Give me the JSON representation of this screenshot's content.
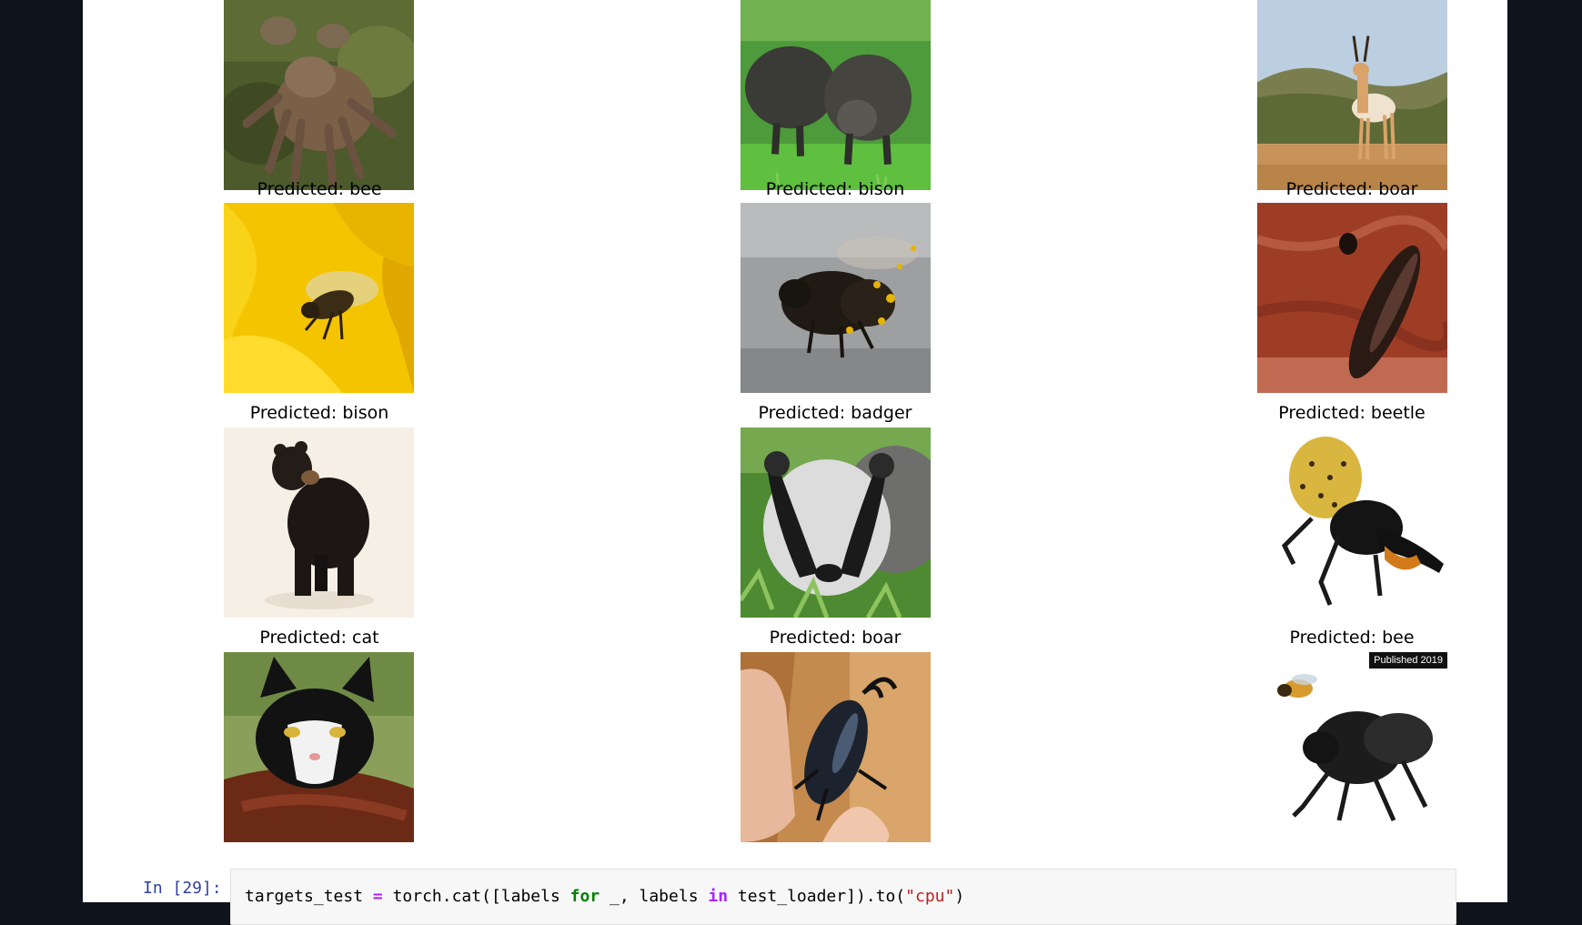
{
  "notebook": {
    "output": {
      "rows": [
        {
          "cells": [
            {
              "caption": "",
              "image": "tarantula-photo"
            },
            {
              "caption": "",
              "image": "boar-photo"
            },
            {
              "caption": "",
              "image": "antelope-photo"
            }
          ]
        },
        {
          "cells": [
            {
              "caption": "Predicted: bee",
              "image": "bee-on-yellow-flower-photo"
            },
            {
              "caption": "Predicted: bison",
              "image": "bee-with-pollen-photo"
            },
            {
              "caption": "Predicted: boar",
              "image": "beetle-on-rust-photo"
            }
          ]
        },
        {
          "cells": [
            {
              "caption": "Predicted: bison",
              "image": "black-bear-photo"
            },
            {
              "caption": "Predicted: badger",
              "image": "badger-photo"
            },
            {
              "caption": "Predicted: beetle",
              "image": "hercules-beetle-photo"
            }
          ]
        },
        {
          "cells": [
            {
              "caption": "Predicted: cat",
              "image": "cat-photo"
            },
            {
              "caption": "Predicted: boar",
              "image": "stag-beetle-in-hand-photo"
            },
            {
              "caption": "Predicted: bee",
              "image": "giant-bee-comparison-photo"
            }
          ]
        }
      ],
      "watermark_text": "Published 2019"
    },
    "next_cell": {
      "prompt": "In [29]:",
      "code": {
        "t1": "targets_test ",
        "t2": "=",
        "t3": " torch.cat([labels ",
        "t4": "for",
        "t5": " _, labels ",
        "t6": "in",
        "t7": " test_loader]).to(",
        "t8": "\"cpu\"",
        "t9": ")"
      }
    }
  }
}
